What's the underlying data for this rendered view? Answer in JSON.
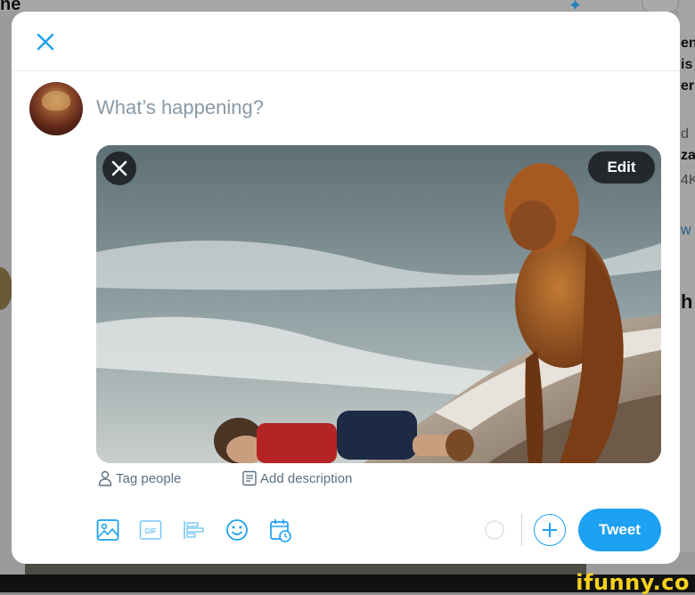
{
  "background": {
    "left_fragment": "ne",
    "right_fragments": [
      "en",
      "is",
      "er",
      "d",
      "za",
      "4K",
      "w",
      "h"
    ]
  },
  "modal": {
    "close_label": "close",
    "composer_placeholder": "What’s happening?",
    "media": {
      "edit_label": "Edit"
    },
    "tag_people_label": "Tag people",
    "add_description_label": "Add description",
    "toolbar": {
      "icons": [
        "media-icon",
        "gif-icon",
        "poll-icon",
        "emoji-icon",
        "schedule-icon"
      ],
      "gif_text": "GIF"
    },
    "tweet_button_label": "Tweet"
  },
  "colors": {
    "accent": "#1da1f2",
    "muted_text": "#5b7083",
    "placeholder": "#8899a6"
  },
  "watermark": {
    "brand": "ifunny.co"
  }
}
